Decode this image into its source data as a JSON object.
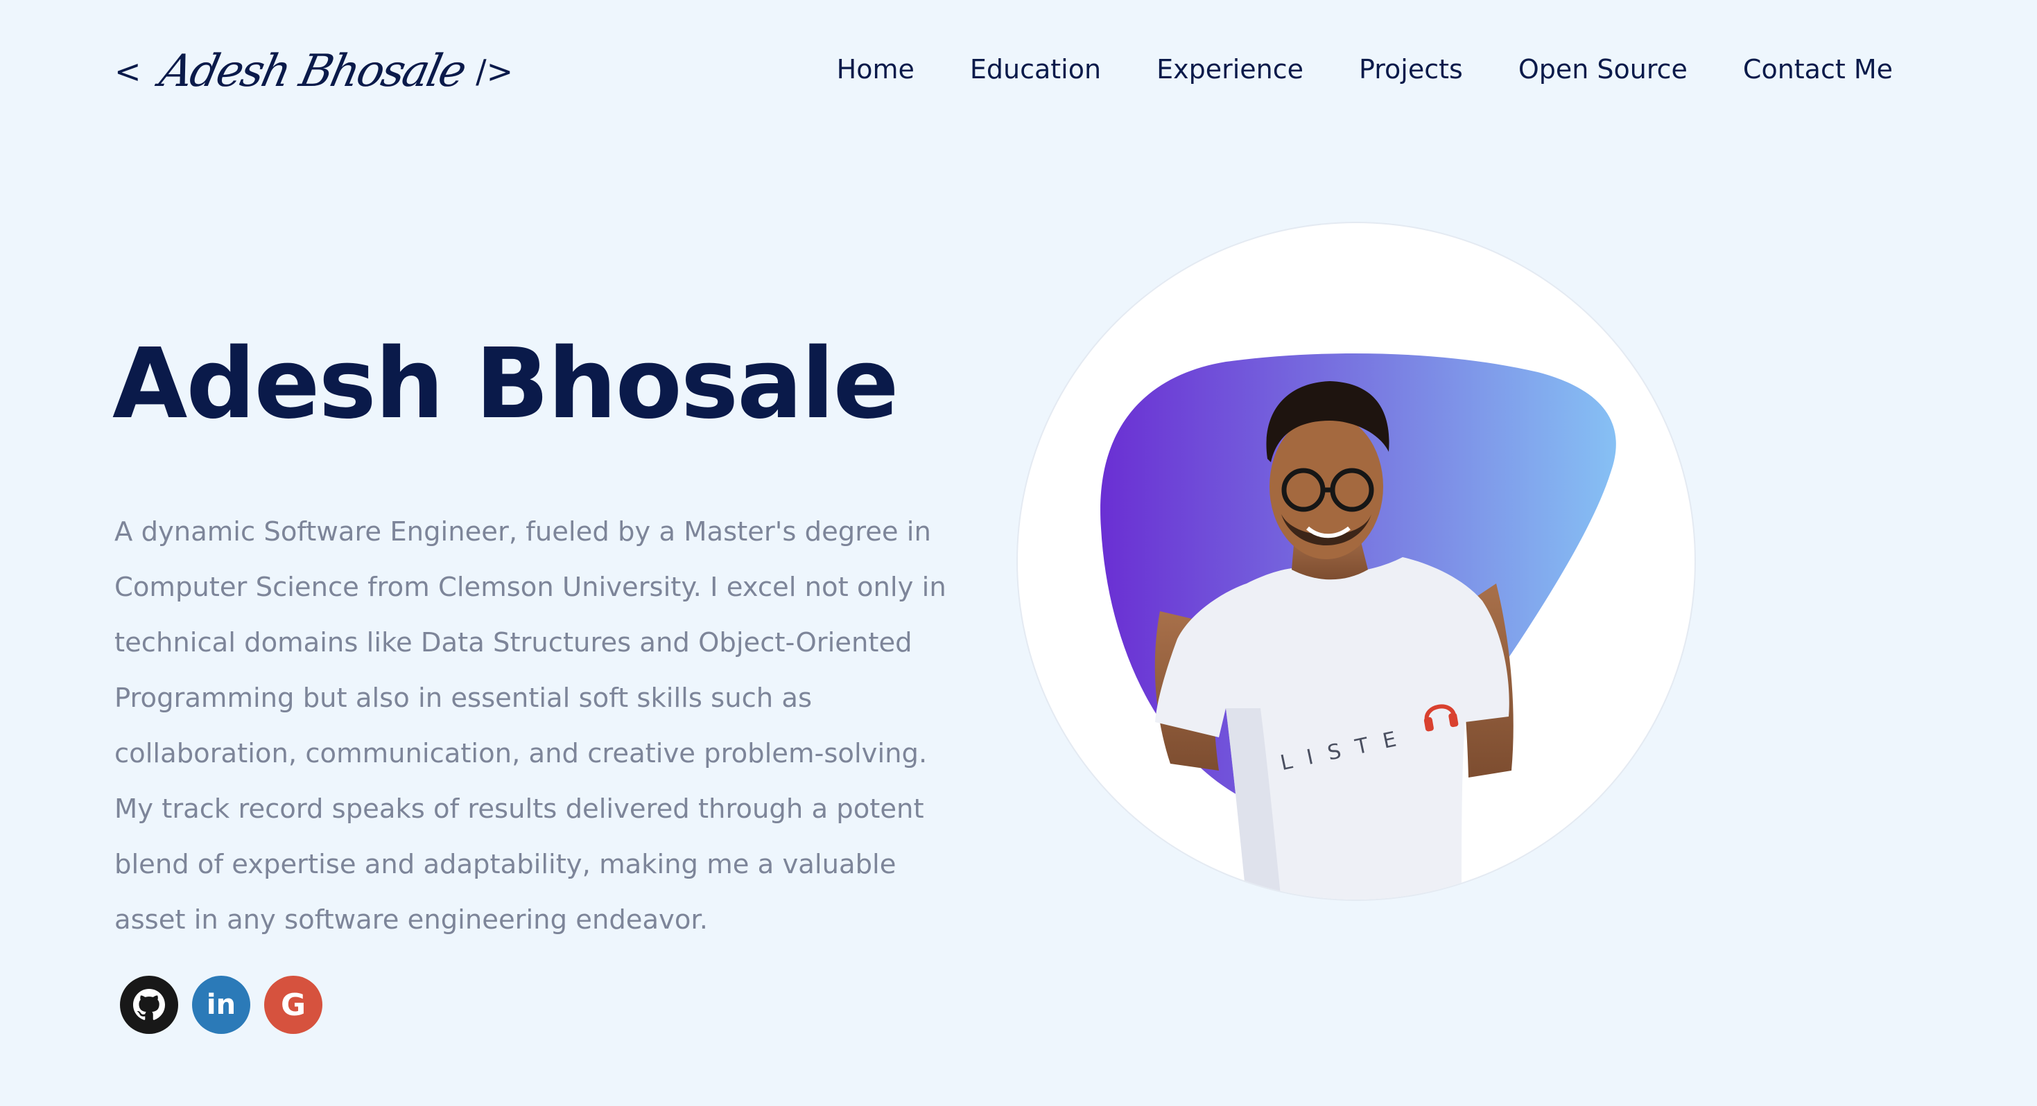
{
  "header": {
    "logo_open": "<",
    "logo_signature": "Adesh Bhosale",
    "logo_close": "/>"
  },
  "nav": {
    "items": [
      {
        "label": "Home"
      },
      {
        "label": "Education"
      },
      {
        "label": "Experience"
      },
      {
        "label": "Projects"
      },
      {
        "label": "Open Source"
      },
      {
        "label": "Contact Me"
      }
    ]
  },
  "hero": {
    "title": "Adesh Bhosale",
    "description": "A dynamic Software Engineer, fueled by a Master's degree in Computer Science from Clemson University. I excel not only in technical domains like Data Structures and Object-Oriented Programming but also in essential soft skills such as collaboration, communication, and creative problem-solving. My track record speaks of results delivered through a potent blend of expertise and adaptability, making me a valuable asset in any software engineering endeavor."
  },
  "socials": [
    {
      "name": "github-icon",
      "color": "#181818"
    },
    {
      "name": "linkedin-icon",
      "color": "#2b7ab8",
      "text": "in"
    },
    {
      "name": "google-icon",
      "color": "#d6523e",
      "text": "G"
    }
  ],
  "portrait": {
    "shirt_text": "LISTE",
    "blob_gradient": [
      "#6a2fd3",
      "#86c0f4"
    ]
  },
  "colors": {
    "background": "#eef6fd",
    "heading": "#0a1a4a",
    "body_text": "#7d8599"
  }
}
